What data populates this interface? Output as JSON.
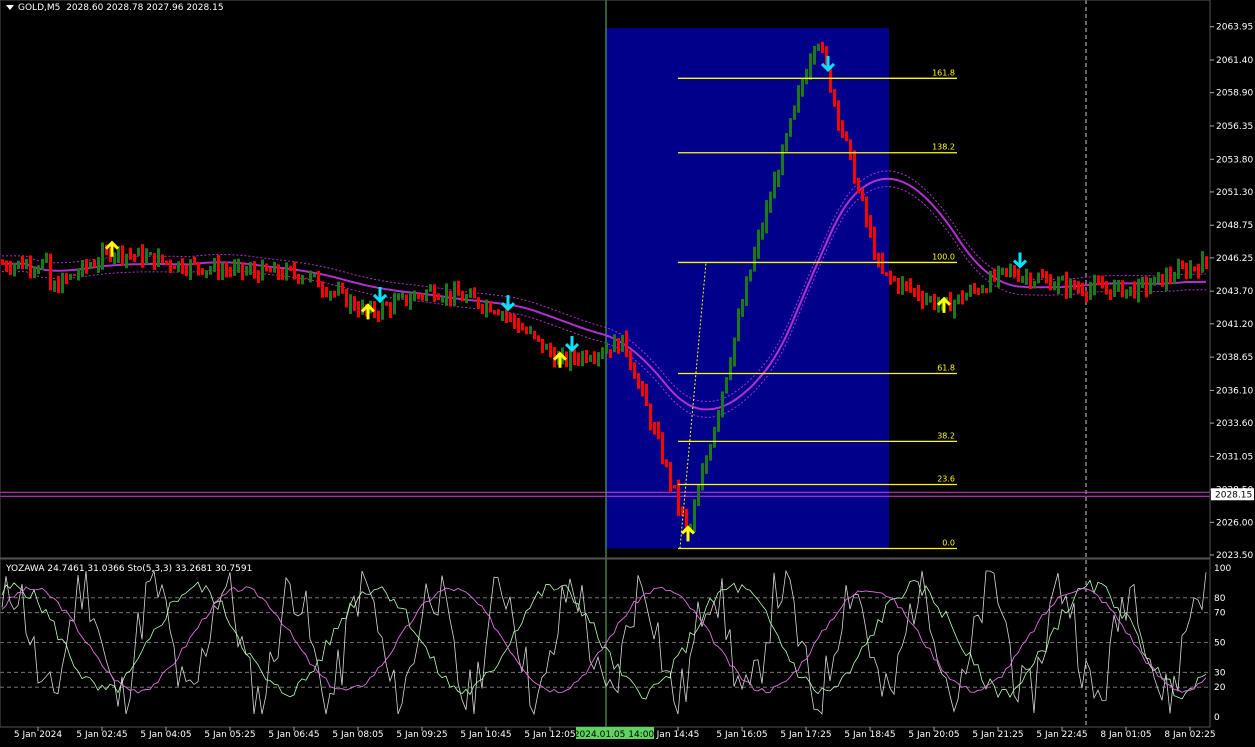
{
  "header": {
    "symbol": "GOLD,M5",
    "ohlc": "2028.60 2028.78 2027.96 2028.15"
  },
  "indicator_header": {
    "text": "YOZAWA 24.7461 31.0366  Sto(5,3,3) 33.2681 30.7591"
  },
  "colors": {
    "background": "#000000",
    "bull": "#1a7a1a",
    "bear": "#ff0000",
    "ma": "#b030d0",
    "fib": "#ffff00",
    "fib_box": "#00008b",
    "arrow_up": "#ffff00",
    "arrow_down": "#00e5ff",
    "current_price_line": "#d040d0",
    "osc_white": "#d8d8d8",
    "osc_green": "#b8ffb8",
    "osc_pink": "#e070e0"
  },
  "price_axis": {
    "ticks": [
      "2063.95",
      "2061.40",
      "2058.90",
      "2056.35",
      "2053.80",
      "2051.30",
      "2048.75",
      "2046.25",
      "2043.70",
      "2041.20",
      "2038.65",
      "2036.10",
      "2033.60",
      "2031.05",
      "2028.50",
      "2026.00",
      "2023.50"
    ],
    "current_price": "2028.15"
  },
  "osc_axis": {
    "ticks": [
      "100",
      "80",
      "70",
      "50",
      "30",
      "20",
      "0"
    ]
  },
  "time_axis": {
    "labels": [
      "5 Jan 2024",
      "5 Jan 02:45",
      "5 Jan 04:05",
      "5 Jan 05:25",
      "5 Jan 06:45",
      "5 Jan 08:05",
      "5 Jan 09:25",
      "5 Jan 10:45",
      "5 Jan 12:05",
      "2024.01.05 14:00",
      "Jan 14:45",
      "5 Jan 16:05",
      "5 Jan 17:25",
      "5 Jan 18:45",
      "5 Jan 20:05",
      "5 Jan 21:25",
      "5 Jan 22:45",
      "8 Jan 01:05",
      "8 Jan 02:25"
    ],
    "highlight_label": "2024.01.05 14:00"
  },
  "fib_levels": [
    {
      "label": "161.8",
      "price": 2060.0
    },
    {
      "label": "138.2",
      "price": 2054.3
    },
    {
      "label": "100.0",
      "price": 2045.9
    },
    {
      "label": "61.8",
      "price": 2037.4
    },
    {
      "label": "38.2",
      "price": 2032.2
    },
    {
      "label": "23.6",
      "price": 2028.9
    },
    {
      "label": "0.0",
      "price": 2024.0
    }
  ],
  "chart_data": {
    "type": "candlestick",
    "title": "",
    "symbol": "GOLD,M5",
    "ylim": [
      2023.5,
      2065.0
    ],
    "current_price": 2028.15,
    "anchor_points": [
      {
        "time": "5 Jan 2024",
        "price": 2043.7
      },
      {
        "time": "5 Jan 02:45",
        "price": 2046.8
      },
      {
        "time": "5 Jan 04:05",
        "price": 2045.8
      },
      {
        "time": "5 Jan 05:25",
        "price": 2045.2
      },
      {
        "time": "5 Jan 06:45",
        "price": 2045.0
      },
      {
        "time": "5 Jan 08:05",
        "price": 2042.0
      },
      {
        "time": "5 Jan 09:25",
        "price": 2043.8
      },
      {
        "time": "5 Jan 10:45",
        "price": 2042.5
      },
      {
        "time": "5 Jan 12:05",
        "price": 2038.3
      },
      {
        "time": "2024.01.05 14:00",
        "price": 2039.8
      },
      {
        "time": "Jan 14:45",
        "price": 2025.0
      },
      {
        "time": "5 Jan 16:05",
        "price": 2046.0
      },
      {
        "time": "5 Jan 17:25",
        "price": 2063.5
      },
      {
        "time": "5 Jan 18:45",
        "price": 2045.0
      },
      {
        "time": "5 Jan 20:05",
        "price": 2042.5
      },
      {
        "time": "5 Jan 21:25",
        "price": 2045.2
      },
      {
        "time": "5 Jan 22:45",
        "price": 2044.0
      },
      {
        "time": "8 Jan 01:05",
        "price": 2043.8
      },
      {
        "time": "8 Jan 02:25",
        "price": 2045.8
      }
    ],
    "oscillator": {
      "name": "Sto(5,3,3)",
      "main": 33.2681,
      "signal": 30.7591,
      "yozawa": [
        24.7461,
        31.0366
      ],
      "levels": [
        80,
        70,
        50,
        30,
        20
      ],
      "ylim": [
        0,
        100
      ]
    },
    "signals": [
      {
        "type": "up",
        "time": "5 Jan 02:45"
      },
      {
        "type": "down",
        "time": "5 Jan 08:05"
      },
      {
        "type": "up",
        "time": "5 Jan 08:05"
      },
      {
        "type": "down",
        "time": "5 Jan 10:45"
      },
      {
        "type": "up",
        "time": "5 Jan 12:05"
      },
      {
        "type": "down",
        "time": "5 Jan 12:05"
      },
      {
        "type": "up",
        "time": "Jan 14:45"
      },
      {
        "type": "down",
        "time": "5 Jan 17:25"
      },
      {
        "type": "up",
        "time": "5 Jan 20:05"
      },
      {
        "type": "down",
        "time": "5 Jan 21:25"
      }
    ]
  }
}
